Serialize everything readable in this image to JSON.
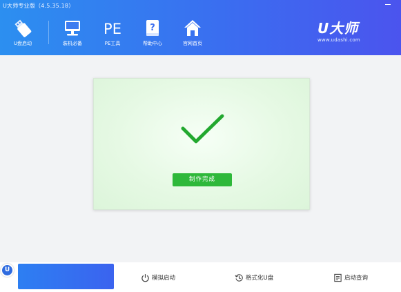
{
  "window": {
    "title": "U大师专业版（4.5.35.18）"
  },
  "nav": {
    "items": [
      {
        "label": "U盘启动",
        "icon": "usb-drive-icon"
      },
      {
        "label": "装机必备",
        "icon": "monitor-icon"
      },
      {
        "label": "PE工具",
        "icon": "pe-text-icon"
      },
      {
        "label": "帮助中心",
        "icon": "help-book-icon"
      },
      {
        "label": "官网首页",
        "icon": "home-icon"
      }
    ],
    "pe_glyph": "PE"
  },
  "logo": {
    "mark": "U大师",
    "url": "www.udashi.com"
  },
  "card": {
    "button_label": "制作完成",
    "icon": "checkmark-icon",
    "accent": "#2eb83a"
  },
  "footer": {
    "badge": "U",
    "items": [
      {
        "label": "模拟启动",
        "icon": "power-icon"
      },
      {
        "label": "格式化U盘",
        "icon": "history-icon"
      },
      {
        "label": "启动查询",
        "icon": "document-icon"
      }
    ]
  },
  "colors": {
    "header_start": "#2c8ff0",
    "header_end": "#4b54ee",
    "background": "#f2f3f5"
  }
}
